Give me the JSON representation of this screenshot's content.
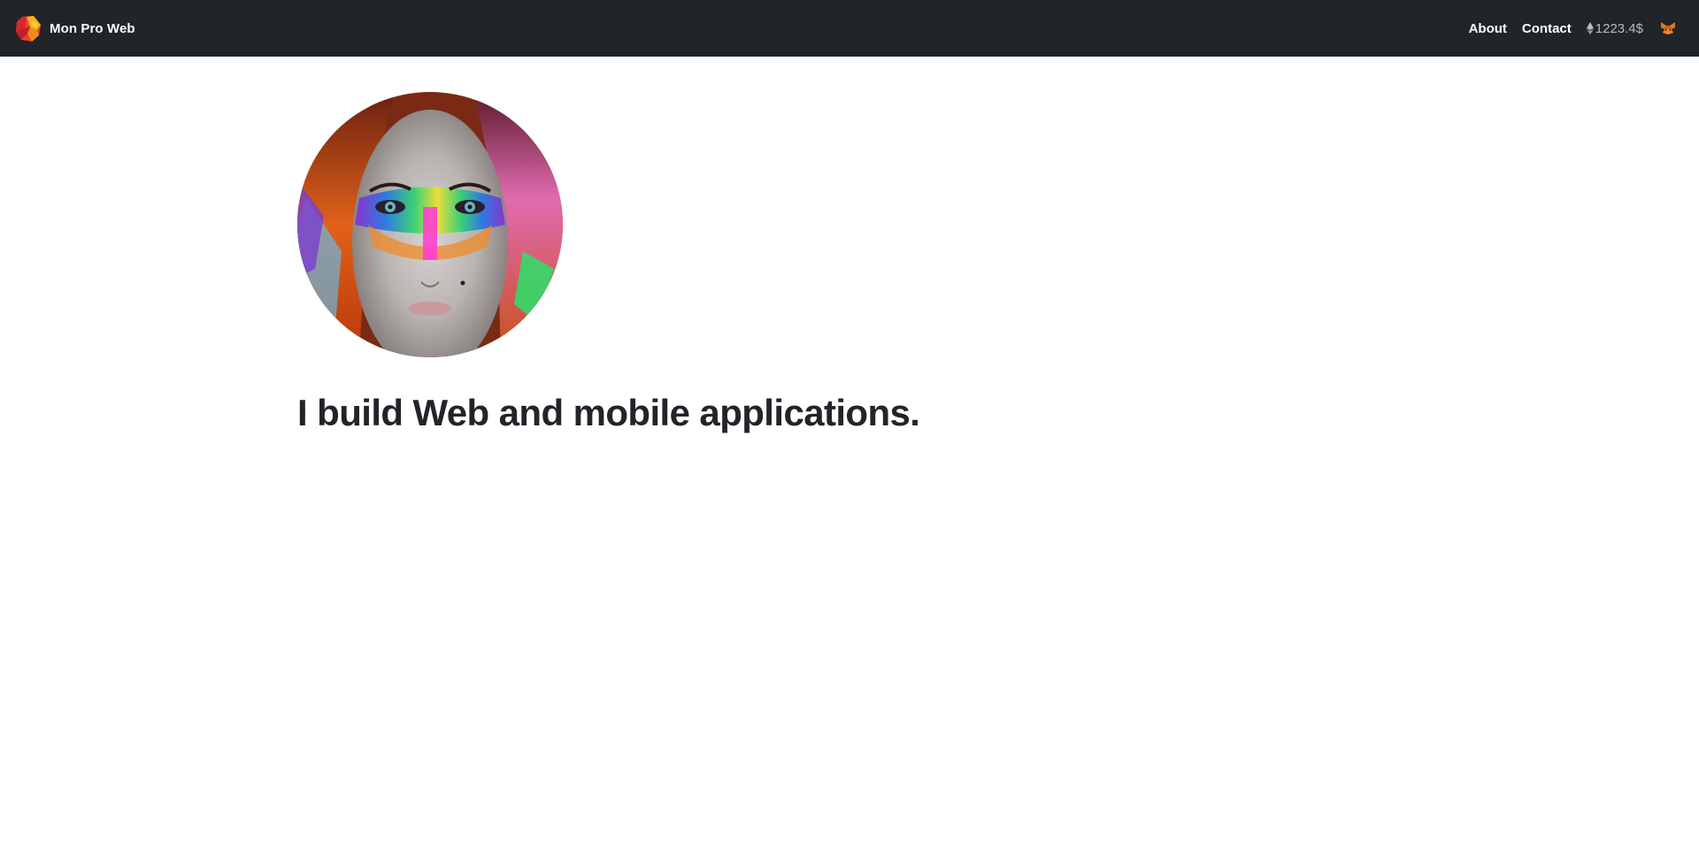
{
  "navbar": {
    "brand_name": "Mon Pro Web",
    "links": [
      {
        "label": "About"
      },
      {
        "label": "Contact"
      }
    ],
    "balance_value": "1223.4$",
    "background_color": "#212529"
  },
  "hero": {
    "headline": "I build Web and mobile applications."
  }
}
